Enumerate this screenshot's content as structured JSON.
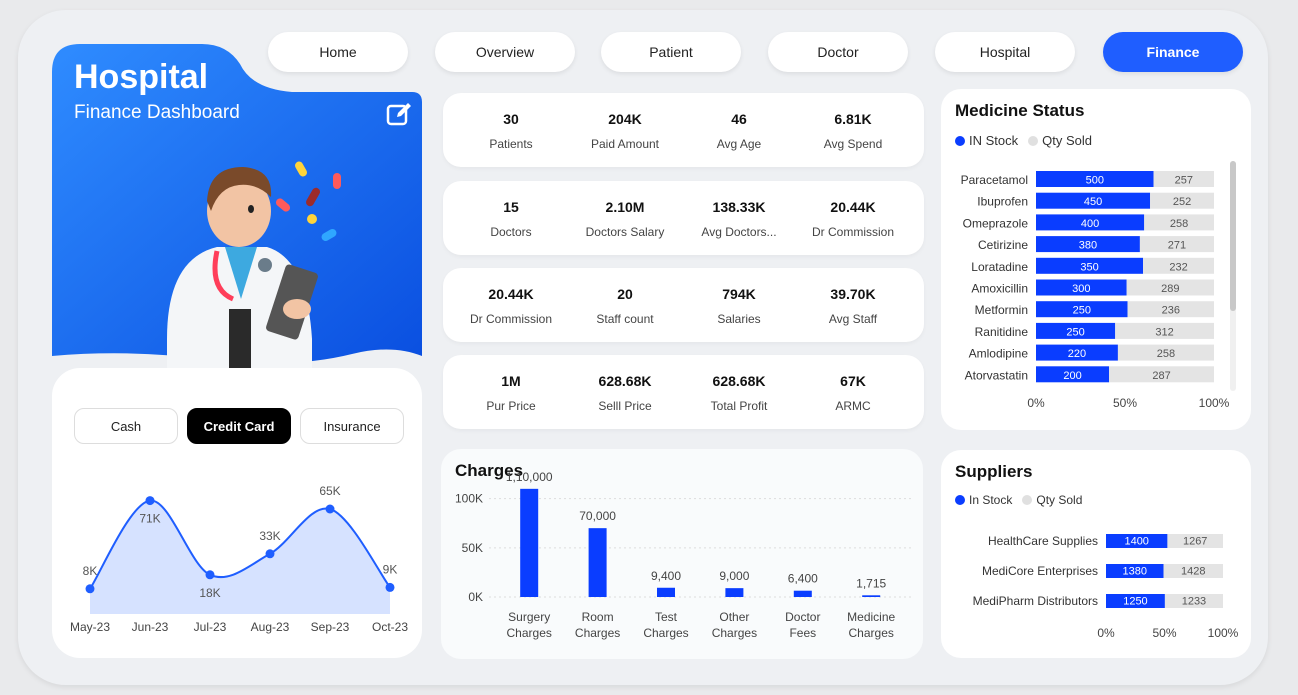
{
  "nav": {
    "items": [
      {
        "label": "Home",
        "active": false
      },
      {
        "label": "Overview",
        "active": false
      },
      {
        "label": "Patient",
        "active": false
      },
      {
        "label": "Doctor",
        "active": false
      },
      {
        "label": "Hospital",
        "active": false
      },
      {
        "label": "Finance",
        "active": true
      }
    ]
  },
  "hero": {
    "title": "Hospital",
    "subtitle": "Finance Dashboard",
    "illustration": "doctor-with-clipboard-and-pills"
  },
  "payment": {
    "options": [
      {
        "label": "Cash",
        "active": false
      },
      {
        "label": "Credit Card",
        "active": true
      },
      {
        "label": "Insurance",
        "active": false
      }
    ]
  },
  "kpis": [
    [
      {
        "value": "30",
        "label": "Patients"
      },
      {
        "value": "204K",
        "label": "Paid Amount"
      },
      {
        "value": "46",
        "label": "Avg Age"
      },
      {
        "value": "6.81K",
        "label": "Avg Spend"
      }
    ],
    [
      {
        "value": "15",
        "label": "Doctors"
      },
      {
        "value": "2.10M",
        "label": "Doctors Salary"
      },
      {
        "value": "138.33K",
        "label": "Avg Doctors..."
      },
      {
        "value": "20.44K",
        "label": "Dr Commission"
      }
    ],
    [
      {
        "value": "20.44K",
        "label": "Dr Commission"
      },
      {
        "value": "20",
        "label": "Staff count"
      },
      {
        "value": "794K",
        "label": "Salaries"
      },
      {
        "value": "39.70K",
        "label": "Avg Staff"
      }
    ],
    [
      {
        "value": "1M",
        "label": "Pur Price"
      },
      {
        "value": "628.68K",
        "label": "Selll Price"
      },
      {
        "value": "628.68K",
        "label": "Total Profit"
      },
      {
        "value": "67K",
        "label": "ARMC"
      }
    ]
  ],
  "colors": {
    "accent": "#1f5eff",
    "bar_blue": "#0a3dff",
    "bar_grey": "#e4e4e4",
    "area_fill": "#d6e2ff",
    "line": "#1f5eff"
  },
  "medicine": {
    "title": "Medicine Status",
    "legend": [
      "IN Stock",
      "Qty Sold"
    ],
    "axis": [
      "0%",
      "50%",
      "100%"
    ]
  },
  "suppliers": {
    "title": "Suppliers",
    "legend": [
      "In Stock",
      "Qty Sold"
    ],
    "axis": [
      "0%",
      "50%",
      "100%"
    ]
  },
  "charges": {
    "title": "Charges"
  },
  "chart_data": [
    {
      "type": "area",
      "categories": [
        "May-23",
        "Jun-23",
        "Jul-23",
        "Aug-23",
        "Sep-23",
        "Oct-23"
      ],
      "values": [
        8,
        71,
        18,
        33,
        65,
        9
      ],
      "data_labels": [
        "8K",
        "71K",
        "18K",
        "33K",
        "65K",
        "9K"
      ],
      "ylim": [
        0,
        80
      ],
      "grid": false
    },
    {
      "type": "bar",
      "title": "Charges",
      "categories": [
        "Surgery Charges",
        "Room Charges",
        "Test Charges",
        "Other Charges",
        "Doctor Fees",
        "Medicine Charges"
      ],
      "category_lines": [
        [
          "Surgery",
          "Charges"
        ],
        [
          "Room",
          "Charges"
        ],
        [
          "Test",
          "Charges"
        ],
        [
          "Other",
          "Charges"
        ],
        [
          "Doctor",
          "Fees"
        ],
        [
          "Medicine",
          "Charges"
        ]
      ],
      "values": [
        110000,
        70000,
        9400,
        9000,
        6400,
        1715
      ],
      "data_labels": [
        "1,10,000",
        "70,000",
        "9,400",
        "9,000",
        "6,400",
        "1,715"
      ],
      "yticks": [
        "0K",
        "50K",
        "100K"
      ],
      "ylim": [
        0,
        120000
      ],
      "grid": true
    },
    {
      "type": "bar",
      "orientation": "horizontal-stacked-100",
      "title": "Medicine Status",
      "categories": [
        "Paracetamol",
        "Ibuprofen",
        "Omeprazole",
        "Cetirizine",
        "Loratadine",
        "Amoxicillin",
        "Metformin",
        "Ranitidine",
        "Amlodipine",
        "Atorvastatin"
      ],
      "series": [
        {
          "name": "IN Stock",
          "values": [
            500,
            450,
            400,
            380,
            350,
            300,
            250,
            250,
            220,
            200
          ]
        },
        {
          "name": "Qty Sold",
          "values": [
            257,
            252,
            258,
            271,
            232,
            289,
            236,
            312,
            258,
            287
          ]
        }
      ],
      "xticks": [
        "0%",
        "50%",
        "100%"
      ]
    },
    {
      "type": "bar",
      "orientation": "horizontal-stacked-100",
      "title": "Suppliers",
      "categories": [
        "HealthCare Supplies",
        "MediCore Enterprises",
        "MediPharm Distributors"
      ],
      "series": [
        {
          "name": "In Stock",
          "values": [
            1400,
            1380,
            1250
          ]
        },
        {
          "name": "Qty Sold",
          "values": [
            1267,
            1428,
            1233
          ]
        }
      ],
      "xticks": [
        "0%",
        "50%",
        "100%"
      ]
    }
  ]
}
